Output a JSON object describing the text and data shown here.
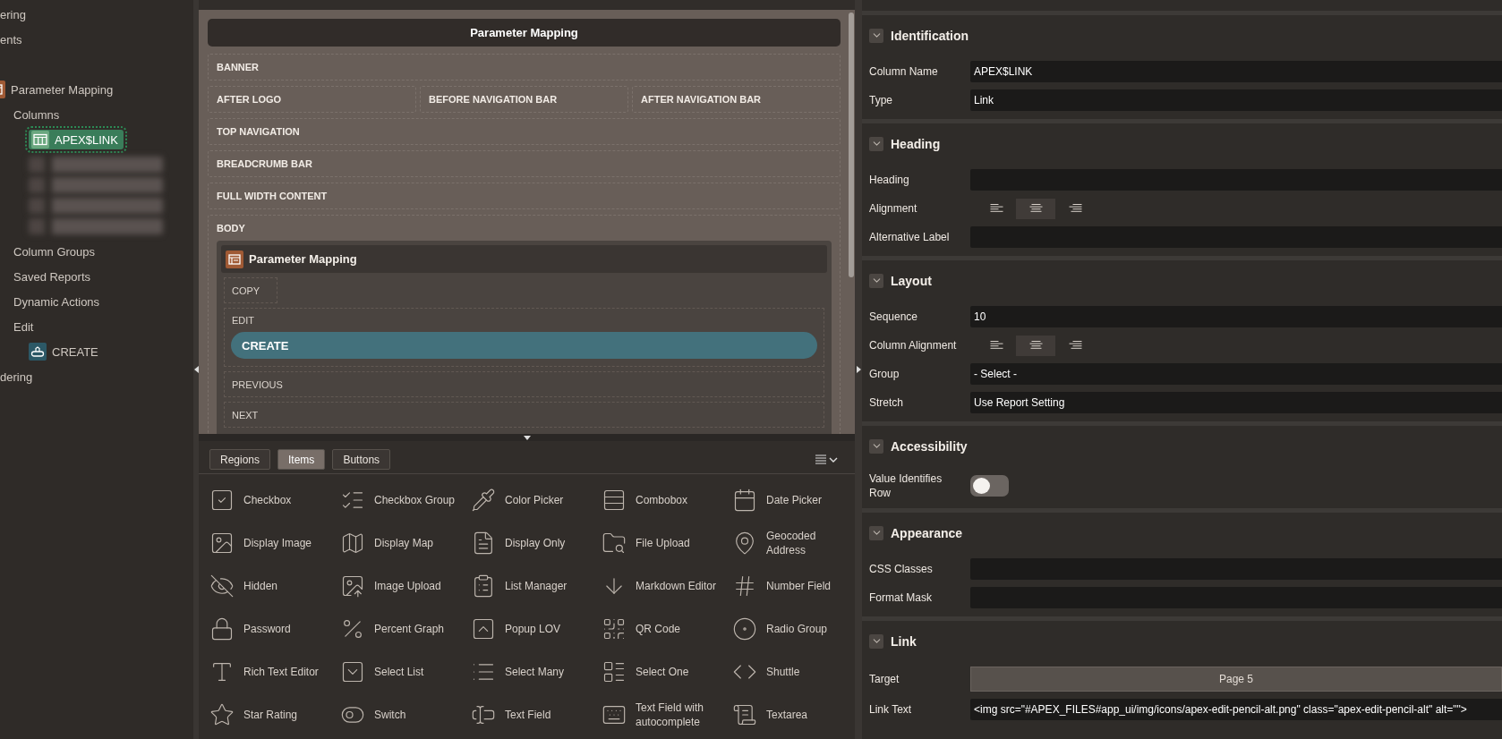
{
  "navigator": {
    "items": [
      {
        "label": "ering",
        "selected": false
      },
      {
        "label": "ents",
        "selected": false
      },
      {
        "label": "Parameter Mapping",
        "kind": "region",
        "selected": false,
        "expanded": true,
        "children": [
          {
            "label": "Columns",
            "selected": false,
            "expanded": true,
            "children": [
              {
                "label": "APEX$LINK",
                "kind": "column",
                "selected": true
              },
              {
                "kind": "blurred"
              },
              {
                "kind": "blurred"
              },
              {
                "kind": "blurred"
              },
              {
                "kind": "blurred"
              }
            ]
          },
          {
            "label": "Column Groups",
            "selected": false
          },
          {
            "label": "Saved Reports",
            "selected": false
          },
          {
            "label": "Dynamic Actions",
            "selected": false
          },
          {
            "label": "Edit",
            "selected": false,
            "expanded": true,
            "children": [
              {
                "label": "CREATE",
                "kind": "button",
                "selected": false
              }
            ]
          }
        ]
      },
      {
        "label": "dering",
        "selected": false
      }
    ]
  },
  "layout": {
    "title": "Parameter Mapping",
    "rows": [
      {
        "cells": [
          "BANNER"
        ]
      },
      {
        "cells": [
          "AFTER LOGO",
          "BEFORE NAVIGATION BAR",
          "AFTER NAVIGATION BAR"
        ]
      },
      {
        "cells": [
          "TOP NAVIGATION"
        ]
      },
      {
        "cells": [
          "BREADCRUMB BAR"
        ]
      },
      {
        "cells": [
          "FULL WIDTH CONTENT"
        ]
      }
    ],
    "body": {
      "label": "BODY",
      "region": {
        "title": "Parameter Mapping",
        "slots": [
          {
            "label": "COPY",
            "kind": "small"
          },
          {
            "label": "EDIT",
            "kind": "slot",
            "button": "CREATE"
          },
          {
            "label": "PREVIOUS",
            "kind": "slot"
          },
          {
            "label": "NEXT",
            "kind": "slot"
          }
        ]
      }
    }
  },
  "gallery": {
    "tabs": [
      {
        "label": "Regions",
        "selected": false
      },
      {
        "label": "Items",
        "selected": true
      },
      {
        "label": "Buttons",
        "selected": false
      }
    ],
    "items": [
      "Checkbox",
      "Checkbox Group",
      "Color Picker",
      "Combobox",
      "Date Picker",
      "Display Image",
      "Display Map",
      "Display Only",
      "File Upload",
      "Geocoded Address",
      "Hidden",
      "Image Upload",
      "List Manager",
      "Markdown Editor",
      "Number Field",
      "Password",
      "Percent Graph",
      "Popup LOV",
      "QR Code",
      "Radio Group",
      "Rich Text Editor",
      "Select List",
      "Select Many",
      "Select One",
      "Shuttle",
      "Star Rating",
      "Switch",
      "Text Field",
      "Text Field with autocomplete",
      "Textarea"
    ]
  },
  "properties": {
    "sections": [
      {
        "title": "Identification",
        "expanded": true,
        "rows": [
          {
            "label": "Column Name",
            "kind": "field",
            "value": "APEX$LINK"
          },
          {
            "label": "Type",
            "kind": "field",
            "value": "Link"
          }
        ]
      },
      {
        "title": "Heading",
        "expanded": true,
        "rows": [
          {
            "label": "Heading",
            "kind": "field"
          },
          {
            "label": "Alignment",
            "kind": "align",
            "options": [
              {
                "selected": false
              },
              {
                "selected": true
              },
              {
                "selected": false
              }
            ]
          },
          {
            "label": "Alternative Label",
            "kind": "field"
          }
        ]
      },
      {
        "title": "Layout",
        "expanded": true,
        "rows": [
          {
            "label": "Sequence",
            "kind": "field",
            "value": "10"
          },
          {
            "label": "Column Alignment",
            "kind": "align",
            "options": [
              {
                "selected": false
              },
              {
                "selected": true
              },
              {
                "selected": false
              }
            ]
          },
          {
            "label": "Group",
            "kind": "field",
            "value": "- Select -"
          },
          {
            "label": "Stretch",
            "kind": "field",
            "value": "Use Report Setting"
          }
        ]
      },
      {
        "title": "Accessibility",
        "expanded": true,
        "rows": [
          {
            "label": "Value Identifies Row",
            "kind": "switch",
            "on": false
          }
        ]
      },
      {
        "title": "Appearance",
        "expanded": true,
        "rows": [
          {
            "label": "CSS Classes",
            "kind": "field"
          },
          {
            "label": "Format Mask",
            "kind": "field"
          }
        ]
      },
      {
        "title": "Link",
        "expanded": true,
        "rows": [
          {
            "label": "Target",
            "kind": "button",
            "value": "Page 5"
          },
          {
            "label": "Link Text",
            "kind": "field",
            "value": "<img src=\"#APEX_FILES#app_ui/img/icons/apex-edit-pencil-alt.png\" class=\"apex-edit-pencil-alt\" alt=\"\">"
          }
        ]
      }
    ]
  }
}
